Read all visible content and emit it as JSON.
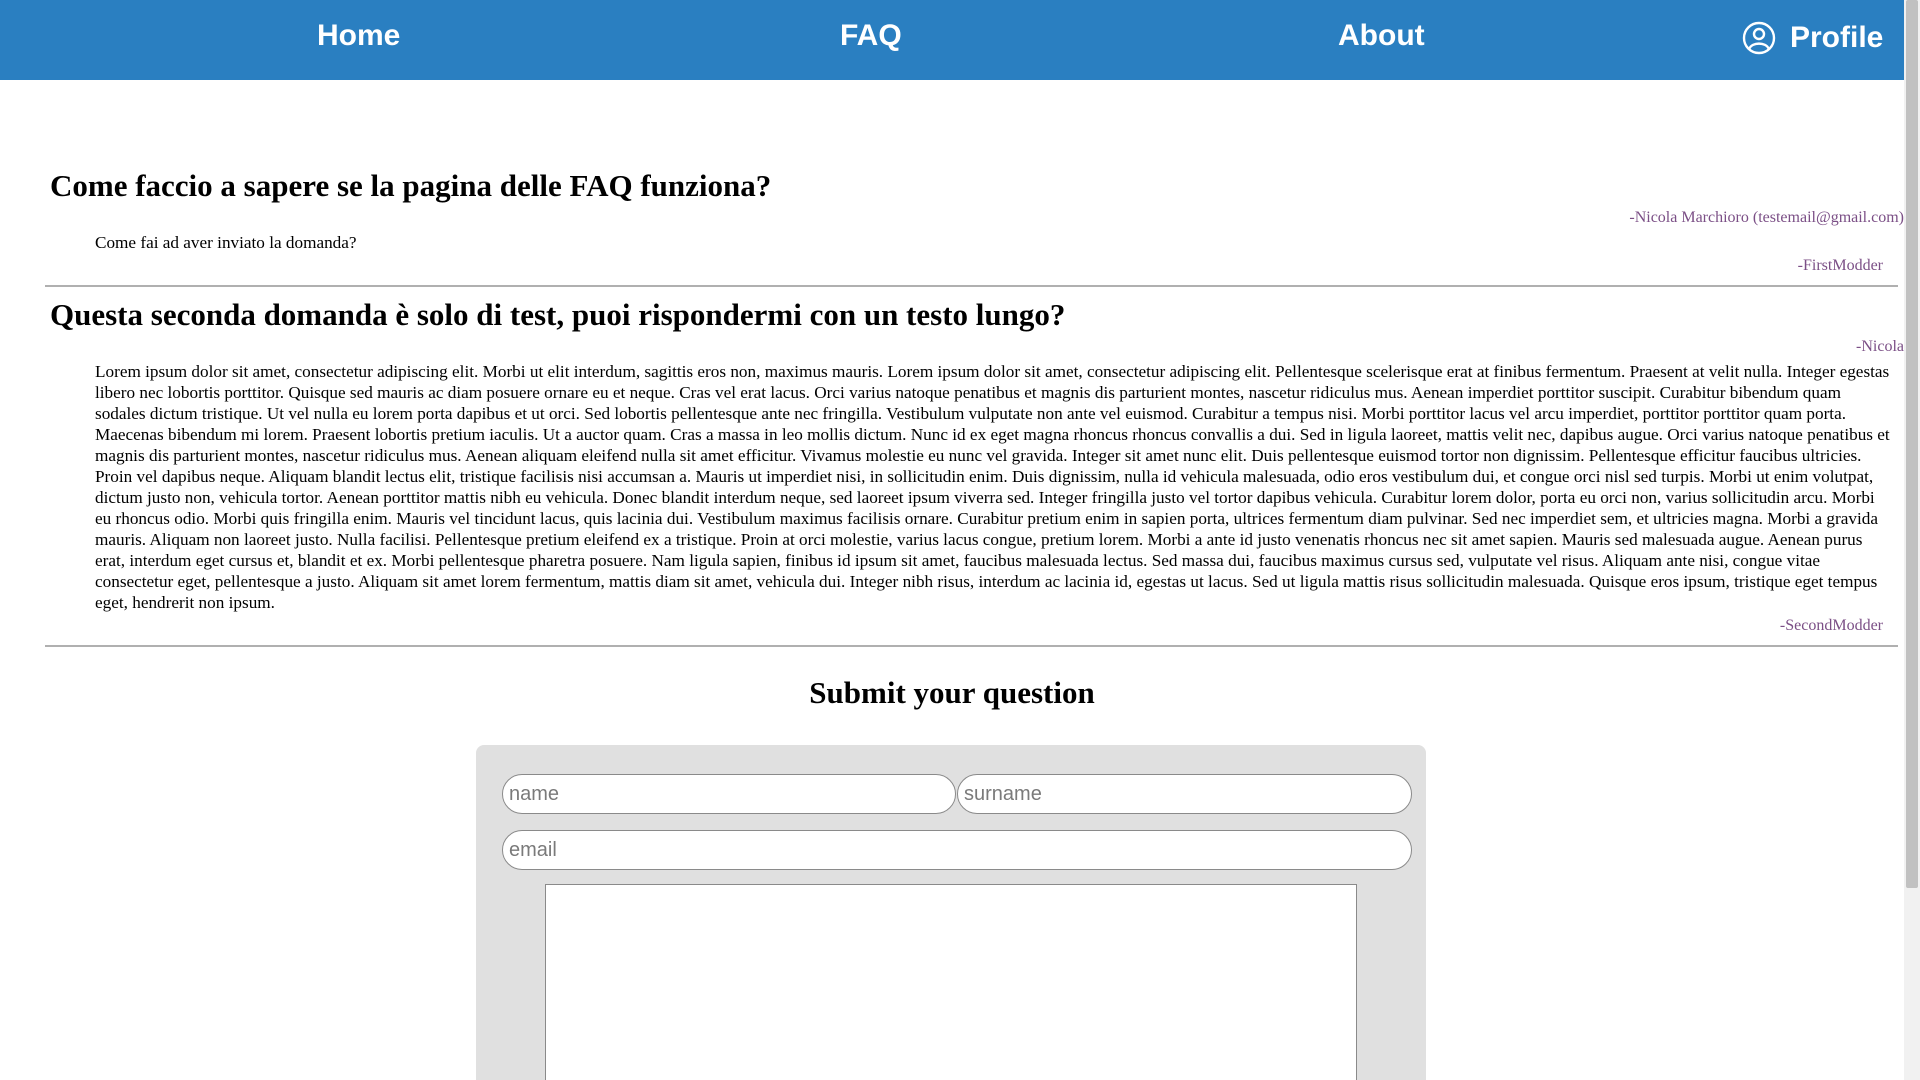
{
  "nav": {
    "home": "Home",
    "faq": "FAQ",
    "about": "About",
    "profile": "Profile"
  },
  "faq": [
    {
      "question": "Come faccio a sapere se la pagina delle FAQ funziona?",
      "author": "-Nicola Marchioro (testemail@gmail.com)",
      "answer": "Come fai ad aver inviato la domanda?",
      "moderator": "-FirstModder"
    },
    {
      "question": "Questa seconda domanda è solo di test, puoi rispondermi con un testo lungo?",
      "author": "-Nicola",
      "answer": "Lorem ipsum dolor sit amet, consectetur adipiscing elit. Morbi ut elit interdum, sagittis eros non, maximus mauris. Lorem ipsum dolor sit amet, consectetur adipiscing elit. Pellentesque scelerisque erat at finibus fermentum. Praesent at velit nulla. Integer egestas libero nec lobortis porttitor. Quisque sed mauris ac diam posuere ornare eu et neque. Cras vel erat lacus. Orci varius natoque penatibus et magnis dis parturient montes, nascetur ridiculus mus. Aenean imperdiet porttitor suscipit. Curabitur bibendum quam sodales dictum tristique. Ut vel nulla eu lorem porta dapibus et ut orci. Sed lobortis pellentesque ante nec fringilla. Vestibulum vulputate non ante vel euismod. Curabitur a tempus nisi. Morbi porttitor lacus vel arcu imperdiet, porttitor porttitor quam porta. Maecenas bibendum mi lorem. Praesent lobortis pretium iaculis. Ut a auctor quam. Cras a massa in leo mollis dictum. Nunc id ex eget magna rhoncus rhoncus convallis a dui. Sed in ligula laoreet, mattis velit nec, dapibus augue. Orci varius natoque penatibus et magnis dis parturient montes, nascetur ridiculus mus. Aenean aliquam eleifend nulla sit amet efficitur. Vivamus molestie eu nunc vel gravida. Integer sit amet nunc elit. Duis pellentesque euismod tortor non dignissim. Pellentesque efficitur faucibus ultricies. Proin vel dapibus neque. Aliquam blandit lectus elit, tristique facilisis nisi accumsan a. Mauris ut imperdiet nisi, in sollicitudin enim. Duis dignissim, nulla id vehicula malesuada, odio eros vestibulum dui, et congue orci nisl sed turpis. Morbi ut enim volutpat, dictum justo non, vehicula tortor. Aenean porttitor mattis nibh eu vehicula. Donec blandit interdum neque, sed laoreet ipsum viverra sed. Integer fringilla justo vel tortor dapibus vehicula. Curabitur lorem dolor, porta eu orci non, varius sollicitudin arcu. Morbi eu rhoncus odio. Morbi quis fringilla enim. Mauris vel tincidunt lacus, quis lacinia dui. Vestibulum maximus facilisis ornare. Curabitur pretium enim in sapien porta, ultrices fermentum diam pulvinar. Sed nec imperdiet sem, et ultricies magna. Morbi a gravida mauris. Aliquam non laoreet justo. Nulla facilisi. Pellentesque pretium eleifend ex a tristique. Proin at orci molestie, varius lacus congue, pretium lorem. Morbi a ante id justo venenatis rhoncus nec sit amet sapien. Mauris sed malesuada augue. Aenean purus erat, interdum eget cursus et, blandit et ex. Morbi pellentesque pharetra posuere. Nam ligula sapien, finibus id ipsum sit amet, faucibus malesuada lectus. Sed massa dui, faucibus maximus cursus sed, vulputate vel risus. Aliquam ante nisi, congue vitae consectetur eget, pellentesque a justo. Aliquam sit amet lorem fermentum, mattis diam sit amet, vehicula dui. Integer nibh risus, interdum ac lacinia id, egestas ut lacus. Sed ut ligula mattis risus sollicitudin malesuada. Quisque eros ipsum, tristique eget tempus eget, hendrerit non ipsum.",
      "moderator": "-SecondModder"
    }
  ],
  "submit": {
    "title": "Submit your question",
    "name_placeholder": "name",
    "surname_placeholder": "surname",
    "email_placeholder": "email"
  },
  "colors": {
    "navbar": "#2a7fc1",
    "author_text": "#7b4f86",
    "form_panel": "#e0e0e0"
  }
}
